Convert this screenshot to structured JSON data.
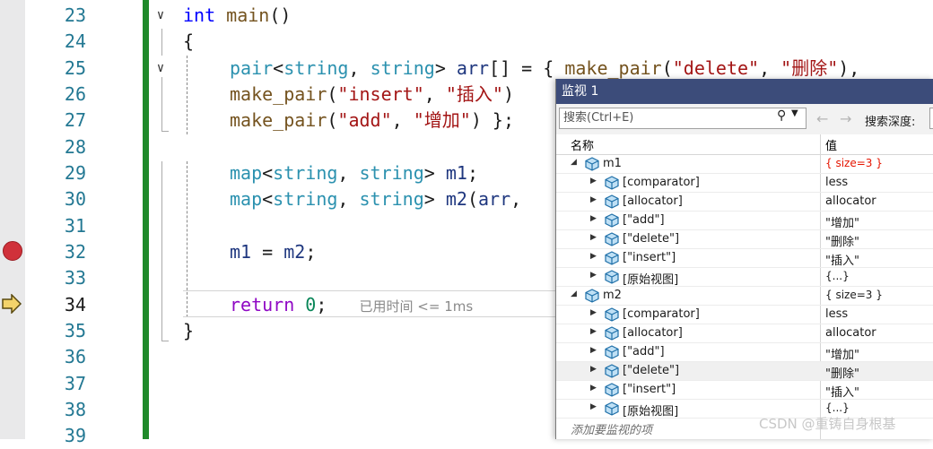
{
  "editor": {
    "line_numbers": [
      "23",
      "24",
      "25",
      "26",
      "27",
      "28",
      "29",
      "30",
      "31",
      "32",
      "33",
      "34",
      "35",
      "36",
      "37",
      "38",
      "39"
    ],
    "current_line": "34",
    "breakpoint_line": "32",
    "elapsed_text": "已用时间 <= 1ms",
    "code": {
      "l23": {
        "kw": "int",
        "fn": "main",
        "rest": "()"
      },
      "l24": "{",
      "l25": {
        "ty": "pair",
        "a": "<",
        "t1": "string",
        "c": ", ",
        "t2": "string",
        "b": "> ",
        "var": "arr",
        "d": "[] = { ",
        "fn": "make_pair",
        "e": "(",
        "s1": "\"delete\"",
        "f": ", ",
        "s2": "\"删除\"",
        "g": "),"
      },
      "l26": {
        "fn": "make_pair",
        "a": "(",
        "s1": "\"insert\"",
        "b": ", ",
        "s2": "\"插入\"",
        "c": ")"
      },
      "l27": {
        "fn": "make_pair",
        "a": "(",
        "s1": "\"add\"",
        "b": ", ",
        "s2": "\"增加\"",
        "c": ") };"
      },
      "l29": {
        "ty": "map",
        "a": "<",
        "t1": "string",
        "c": ", ",
        "t2": "string",
        "b": "> ",
        "var": "m1",
        "d": ";"
      },
      "l30": {
        "ty": "map",
        "a": "<",
        "t1": "string",
        "c": ", ",
        "t2": "string",
        "b": "> ",
        "var": "m2",
        "d": "(",
        "var2": "arr",
        "e": ","
      },
      "l32": {
        "v1": "m1",
        "a": " = ",
        "v2": "m2",
        "b": ";"
      },
      "l34": {
        "kw": "return",
        "a": " ",
        "num": "0",
        "b": ";"
      },
      "l35": "}"
    }
  },
  "watch": {
    "title": "监视 1",
    "search_placeholder": "搜索(Ctrl+E)",
    "search_depth_label": "搜索深度:",
    "col_name": "名称",
    "col_value": "值",
    "add_item": "添加要监视的项",
    "rows": [
      {
        "name": "m1",
        "value": "{ size=3 }"
      },
      {
        "name": "[comparator]",
        "value": "less"
      },
      {
        "name": "[allocator]",
        "value": "allocator"
      },
      {
        "name": "[\"add\"]",
        "value": "\"增加\""
      },
      {
        "name": "[\"delete\"]",
        "value": "\"删除\""
      },
      {
        "name": "[\"insert\"]",
        "value": "\"插入\""
      },
      {
        "name": "[原始视图]",
        "value": "{...}"
      },
      {
        "name": "m2",
        "value": "{ size=3 }"
      },
      {
        "name": "[comparator]",
        "value": "less"
      },
      {
        "name": "[allocator]",
        "value": "allocator"
      },
      {
        "name": "[\"add\"]",
        "value": "\"增加\""
      },
      {
        "name": "[\"delete\"]",
        "value": "\"删除\""
      },
      {
        "name": "[\"insert\"]",
        "value": "\"插入\""
      },
      {
        "name": "[原始视图]",
        "value": "{...}"
      }
    ]
  },
  "watermark": "CSDN @重铸自身根基",
  "colors": {
    "accent_green": "#1f8a2a",
    "title_bar": "#3c4c7a",
    "changed_value": "#e51400",
    "breakpoint": "#d0313a"
  }
}
